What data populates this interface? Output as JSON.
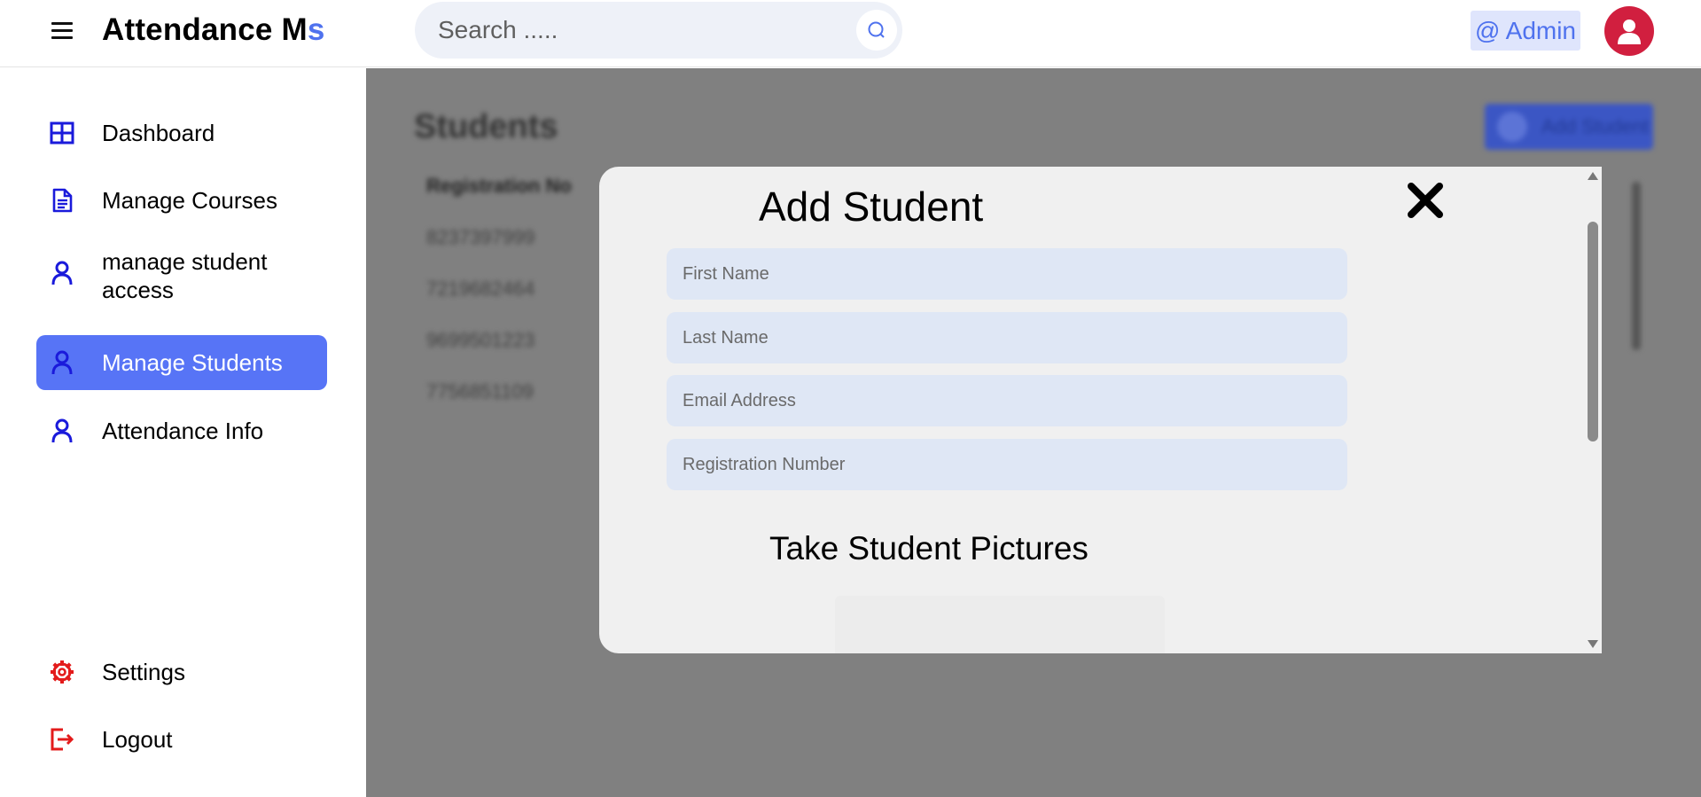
{
  "header": {
    "brand_main": "Attendance M",
    "brand_accent": "s",
    "search_placeholder": "Search .....",
    "admin_label": "@ Admin"
  },
  "sidebar": {
    "items": [
      {
        "label": "Dashboard",
        "icon": "grid-icon",
        "active": false
      },
      {
        "label": "Manage Courses",
        "icon": "document-icon",
        "active": false
      },
      {
        "label": "manage student access",
        "icon": "user-icon",
        "active": false
      },
      {
        "label": "Manage Students",
        "icon": "user-icon",
        "active": true
      },
      {
        "label": "Attendance Info",
        "icon": "user-icon",
        "active": false
      }
    ],
    "bottom_items": [
      {
        "label": "Settings",
        "icon": "gear-icon"
      },
      {
        "label": "Logout",
        "icon": "logout-icon"
      }
    ]
  },
  "main": {
    "title": "Students",
    "add_button": "Add Student",
    "column_header": "Registration No",
    "rows": [
      "8237397999",
      "7219682464",
      "9699501223",
      "7756851109"
    ]
  },
  "modal": {
    "title": "Add Student",
    "close_symbol": "✖",
    "fields": {
      "first_name": "First Name",
      "last_name": "Last Name",
      "email": "Email Address",
      "registration": "Registration Number"
    },
    "pictures_title": "Take Student Pictures"
  },
  "colors": {
    "accent": "#4f72ee",
    "active_nav": "#5774f6",
    "nav_icon": "#1a1adb",
    "danger_icon": "#e31b1b",
    "avatar": "#d11f3f",
    "overlay": "#808080"
  }
}
